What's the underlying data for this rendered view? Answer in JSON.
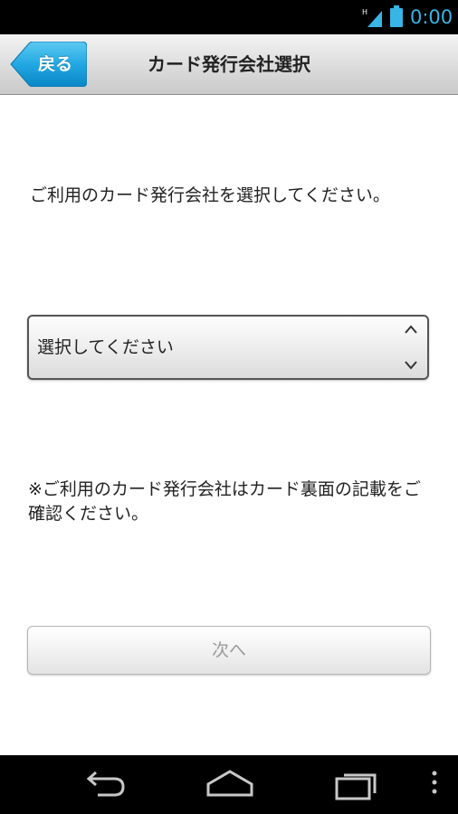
{
  "status_bar": {
    "time": "0:00",
    "network_type": "H",
    "icons": [
      "signal-icon",
      "battery-icon"
    ],
    "accent_color": "#36b5e6"
  },
  "header": {
    "back_label": "戻る",
    "title": "カード発行会社選択",
    "back_button_color": "#1fa6e0"
  },
  "main": {
    "instruction": "ご利用のカード発行会社を選択してください。",
    "select": {
      "selected_value": "選択してください",
      "icons": [
        "chevron-up-icon",
        "chevron-down-icon"
      ]
    },
    "note": "※ご利用のカード発行会社はカード裏面の記載をご確認ください。",
    "next_label": "次へ"
  },
  "nav_bar": {
    "icons": [
      "back-arrow-icon",
      "home-icon",
      "recent-apps-icon",
      "overflow-menu-icon"
    ]
  }
}
